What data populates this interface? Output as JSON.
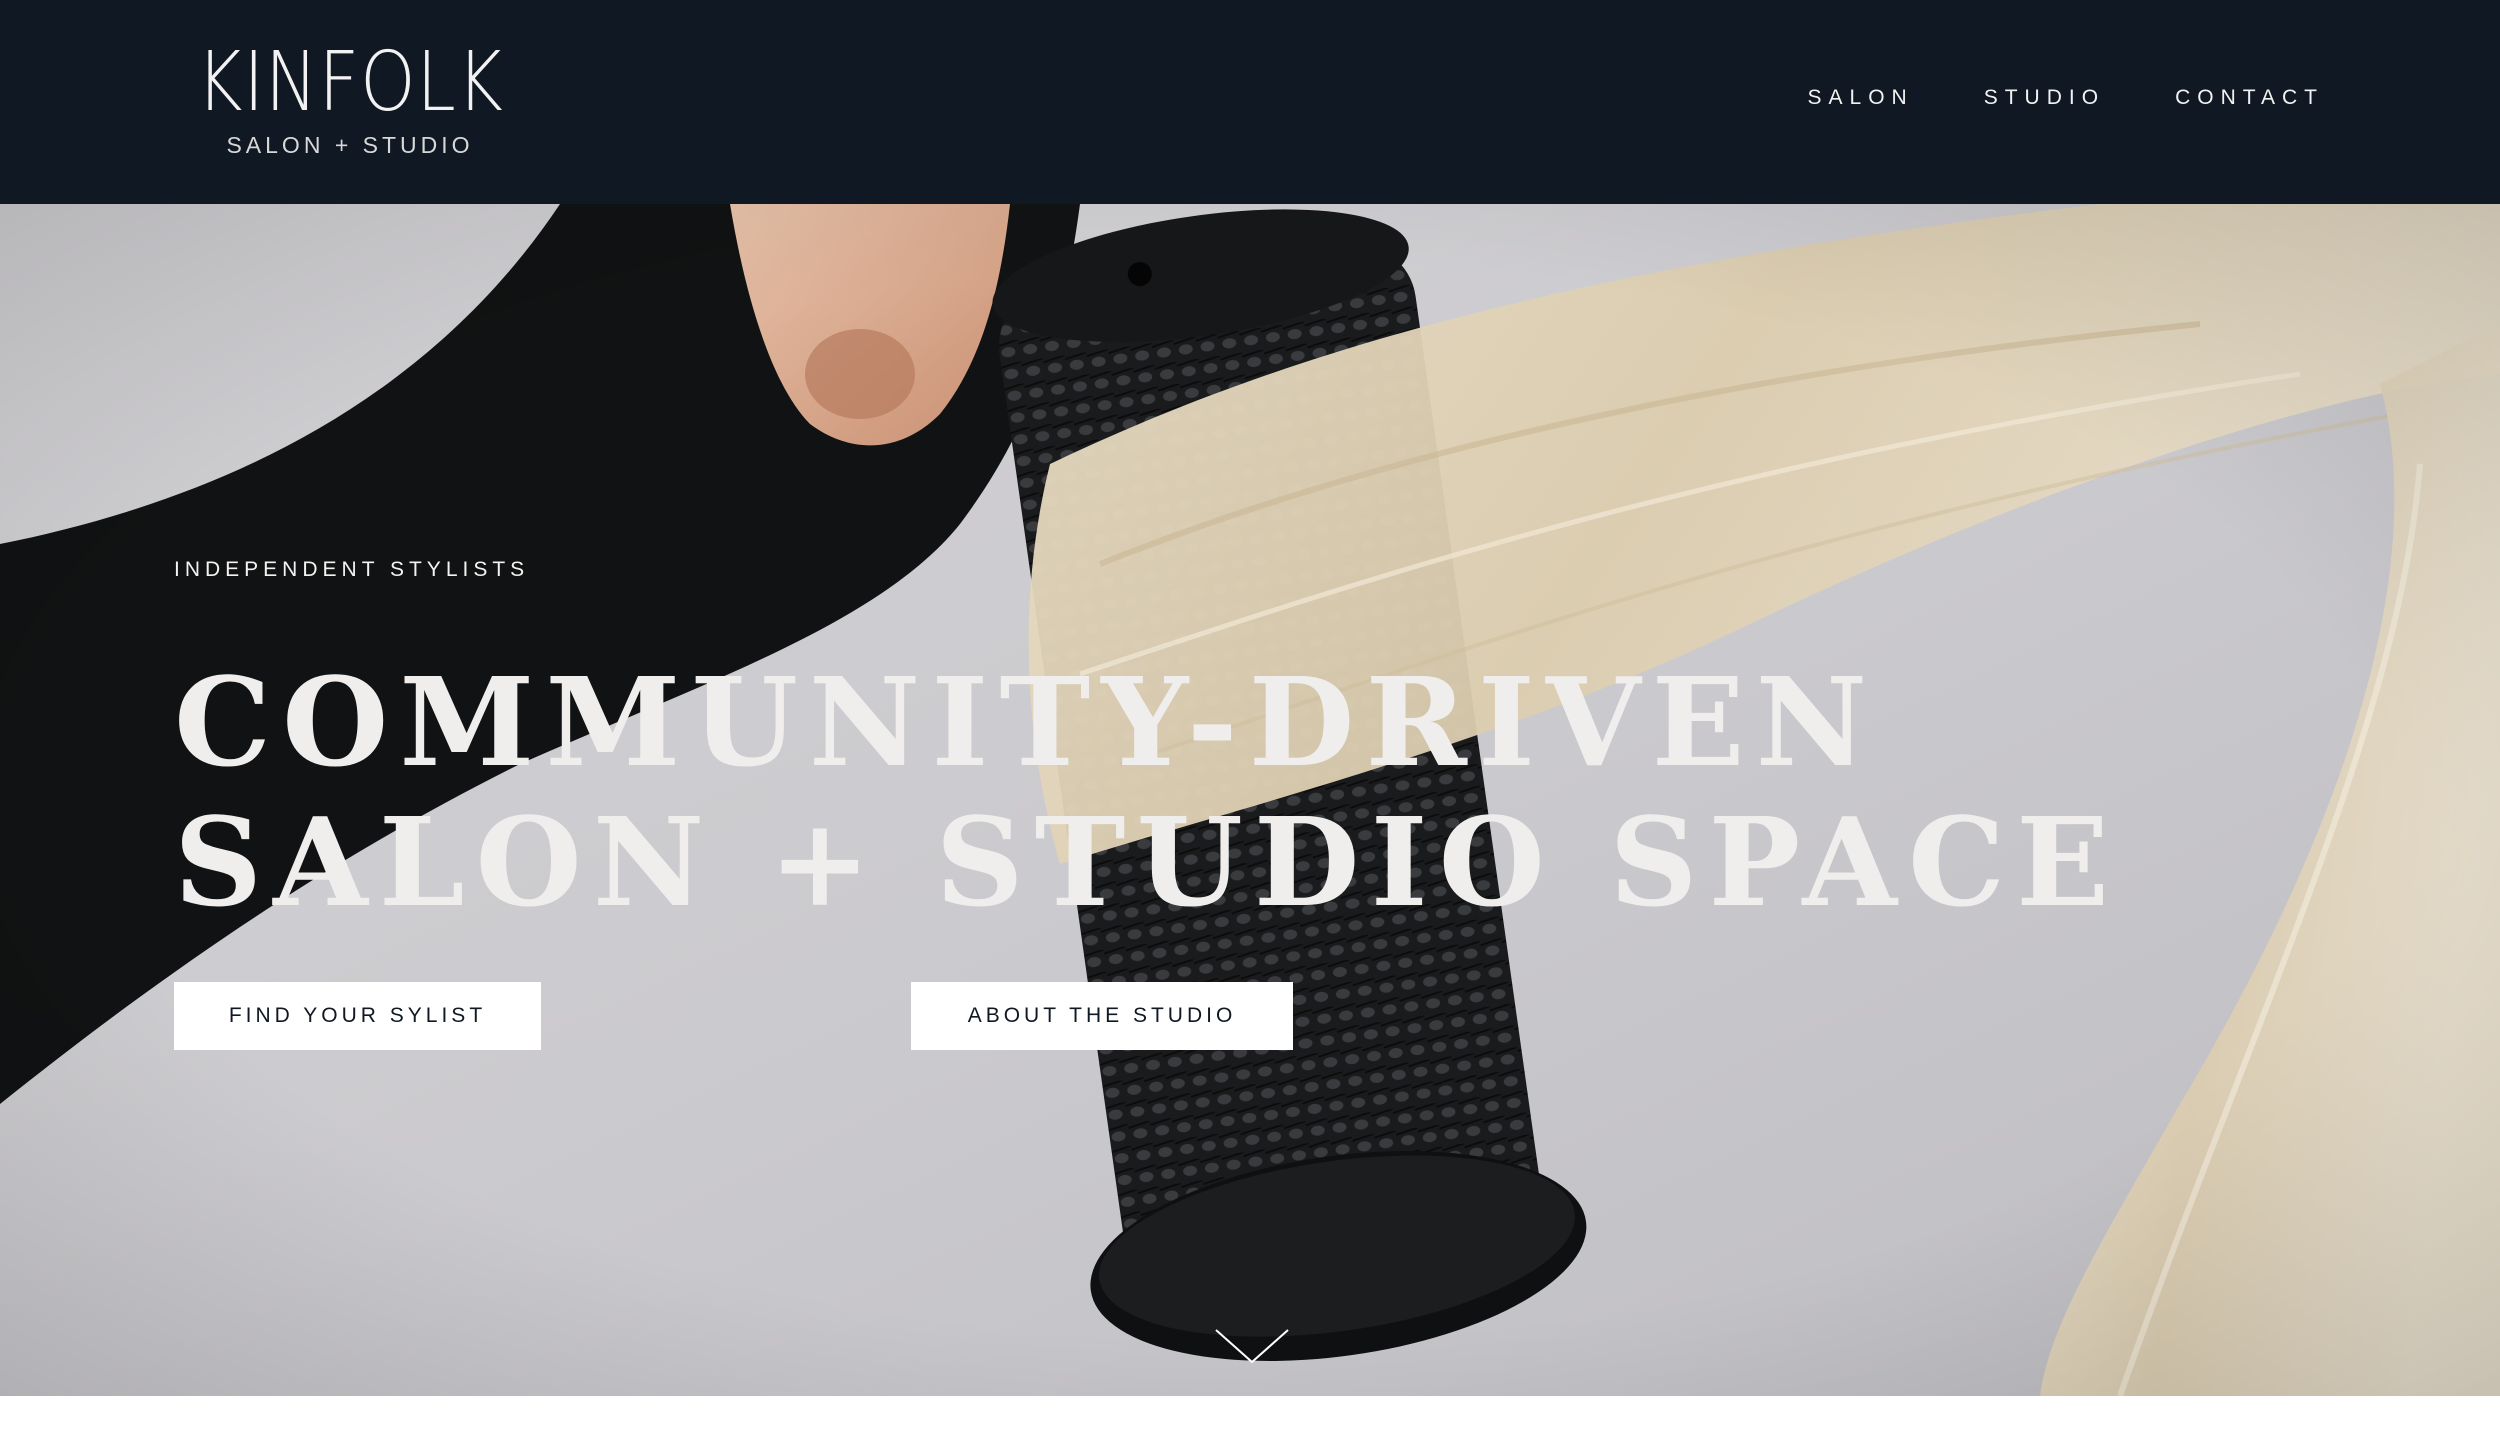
{
  "header": {
    "logo": {
      "main": "KINFOLK",
      "sub": "SALON + STUDIO"
    },
    "nav": [
      {
        "label": "SALON"
      },
      {
        "label": "STUDIO"
      },
      {
        "label": "CONTACT"
      }
    ]
  },
  "hero": {
    "eyebrow": "INDEPENDENT STYLISTS",
    "headline_line1": "COMMUNITY-DRIVEN",
    "headline_line2": "SALON + STUDIO SPACE",
    "buttons": {
      "find": "FIND YOUR SYLIST",
      "about": "ABOUT THE STUDIO"
    },
    "scroll_icon": "chevron-down-icon",
    "background_photo": "hand holding round brush through blonde hair"
  },
  "colors": {
    "header_bg": "#101823",
    "hero_text": "#f4f3f1",
    "button_bg": "#ffffff",
    "button_text": "#101823"
  }
}
